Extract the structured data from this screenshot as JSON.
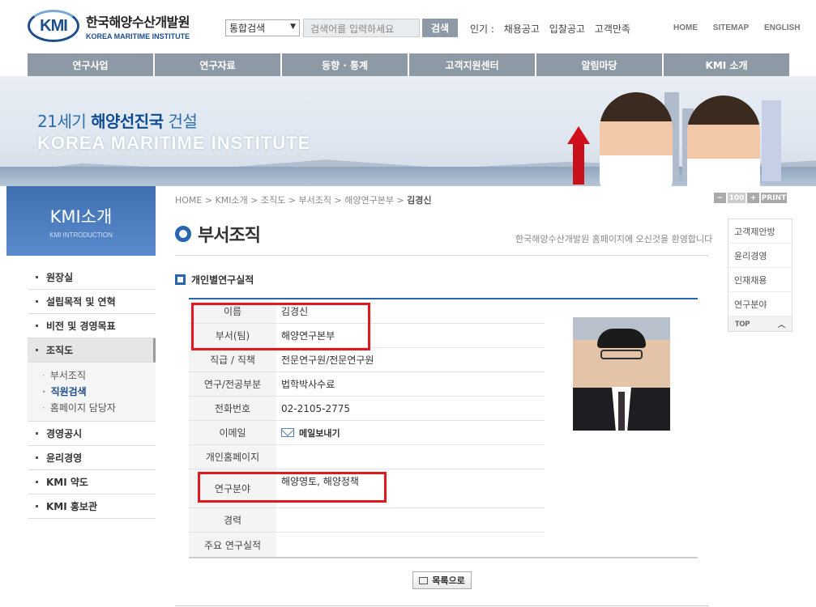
{
  "header": {
    "logo_mark": "KMI",
    "logo_ko": "한국해양수산개발원",
    "logo_en": "KOREA MARITIME INSTITUTE",
    "search_select": "통합검색",
    "search_placeholder": "검색어를 입력하세요",
    "search_button": "검색",
    "popular_label": "인기 :",
    "popular": [
      "채용공고",
      "입찰공고",
      "고객만족"
    ],
    "util": [
      "HOME",
      "SITEMAP",
      "ENGLISH"
    ]
  },
  "gnb": [
    "연구사업",
    "연구자료",
    "동향 · 통계",
    "고객지원센터",
    "알림마당",
    "KMI 소개"
  ],
  "banner": {
    "line1_pre": "21세기",
    "line1_bold": "해양선진국",
    "line1_post": "건설",
    "line2": "KOREA MARITIME INSTITUTE"
  },
  "lnb": {
    "title": "KMI소개",
    "subtitle": "KMI INTRODUCTION",
    "items": [
      "원장실",
      "설립목적 및 연혁",
      "비전 및 경영목표",
      "조직도",
      "경영공시",
      "윤리경영",
      "KMI 약도",
      "KMI 홍보관"
    ],
    "sub": [
      "부서조직",
      "직원검색",
      "홈페이지 담당자"
    ]
  },
  "breadcrumb": {
    "path": "HOME > KMI소개 > 조직도 > 부서조직 > 해양연구본부 >",
    "current": "김경신"
  },
  "tools": {
    "minus": "−",
    "zoom": "100",
    "plus": "+",
    "print": "PRINT"
  },
  "page": {
    "title": "부서조직",
    "welcome": "한국해양수산개발원 홈페이지에 오신것을 환영합니다",
    "section": "개인별연구실적"
  },
  "profile": {
    "rows": [
      {
        "label": "이름",
        "value": "김경신"
      },
      {
        "label": "부서(팀)",
        "value": "해양연구본부"
      },
      {
        "label": "직급 / 직책",
        "value": "전문연구원/전문연구원"
      },
      {
        "label": "연구/전공부분",
        "value": "법학박사수료"
      },
      {
        "label": "전화번호",
        "value": "02-2105-2775"
      },
      {
        "label": "이메일",
        "value": "메일보내기"
      },
      {
        "label": "개인홈페이지",
        "value": ""
      },
      {
        "label": "연구분야",
        "value": "해양영토, 해양정책"
      },
      {
        "label": "경력",
        "value": ""
      },
      {
        "label": "주요 연구실적",
        "value": ""
      }
    ]
  },
  "list_button": "목록으로",
  "quick": {
    "items": [
      "고객제안방",
      "윤리경영",
      "인재채용",
      "연구분야"
    ],
    "top": "TOP"
  },
  "colors": {
    "nav_gray": "#8d9aa6",
    "brand_blue": "#2866b0",
    "highlight_red": "#e4161e"
  }
}
